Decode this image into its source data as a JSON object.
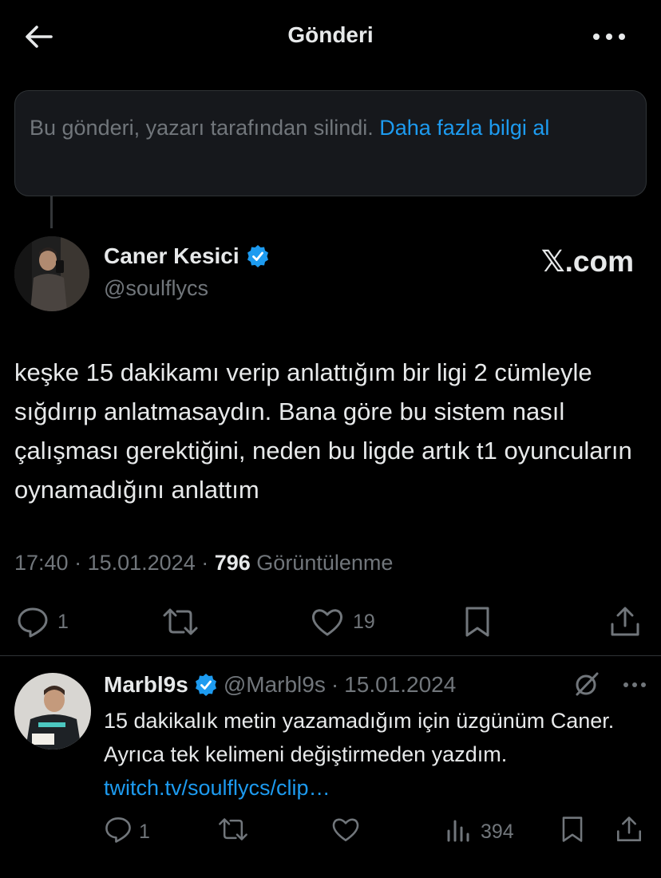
{
  "header": {
    "title": "Gönderi"
  },
  "deleted_notice": {
    "text": "Bu gönderi, yazarı tarafından silindi. ",
    "link": "Daha fazla bilgi al"
  },
  "post": {
    "author_name": "Caner Kesici",
    "author_handle": "@soulflycs",
    "source_label": "𝕏.com",
    "text": "keşke 15 dakikamı verip anlattığım bir ligi 2 cümleyle sığdırıp anlatmasaydın. Bana göre bu sistem nasıl çalışması gerektiğini, neden bu ligde artık t1 oyuncuların oynamadığını anlattım",
    "time": "17:40",
    "date": "15.01.2024",
    "views_count": "796",
    "views_label": "Görüntülenme",
    "reply_count": "1",
    "like_count": "19"
  },
  "reply": {
    "author_name": "Marbl9s",
    "author_handle": "@Marbl9s",
    "date": "15.01.2024",
    "text": "15 dakikalık metin yazamadığım için üzgünüm Caner. Ayrıca tek kelimeni değiştirmeden yazdım. ",
    "link": "twitch.tv/soulflycs/clip…",
    "reply_count": "1",
    "views_count": "394"
  },
  "colors": {
    "background": "#000000",
    "text": "#e7e9ea",
    "muted": "#71767b",
    "accent": "#1d9bf0",
    "border": "#2f3336"
  }
}
